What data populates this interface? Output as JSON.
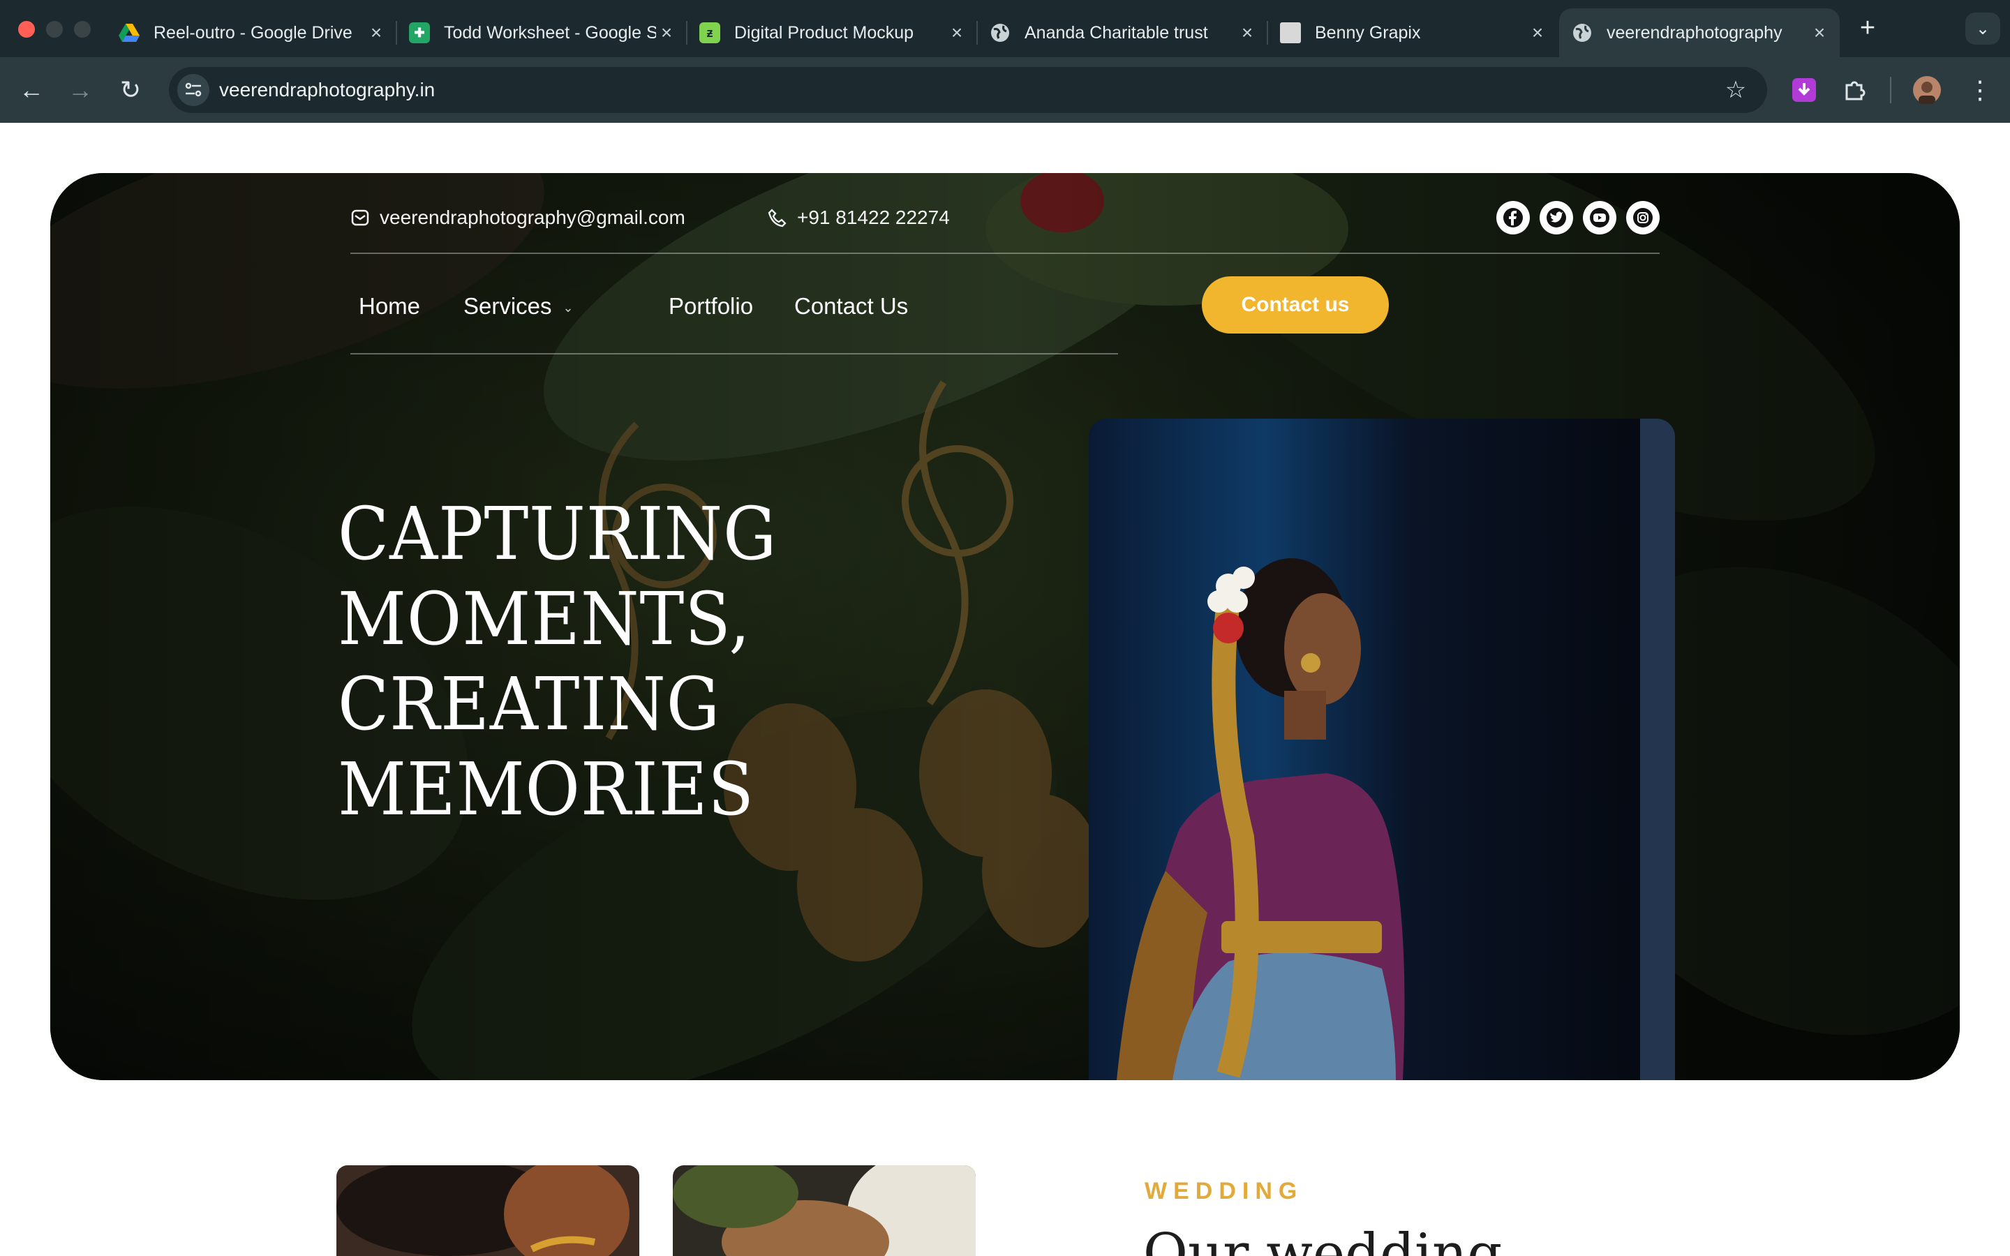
{
  "browser": {
    "tabs": [
      {
        "title": "Reel-outro - Google Drive",
        "favicon": "google-drive-icon",
        "active": false
      },
      {
        "title": "Todd Worksheet - Google Sheets",
        "favicon": "google-sheets-icon",
        "active": false
      },
      {
        "title": "Digital Product Mockup",
        "favicon": "mockup-app-icon",
        "active": false
      },
      {
        "title": "Ananda Charitable trust",
        "favicon": "globe-icon",
        "active": false
      },
      {
        "title": "Benny Grapix",
        "favicon": "site-thumbnail-icon",
        "active": false
      },
      {
        "title": "veerendraphotography",
        "favicon": "globe-icon",
        "active": true
      }
    ],
    "url": "veerendraphotography.in",
    "colors": {
      "tabbar": "#1c2a2f",
      "toolbar": "#2b3b40",
      "close_dot": "#fe5f57"
    }
  },
  "site": {
    "email": "veerendraphotography@gmail.com",
    "phone": "+91 81422 22274",
    "socials": [
      "facebook-icon",
      "twitter-icon",
      "youtube-icon",
      "instagram-icon"
    ],
    "nav": {
      "home": "Home",
      "services": "Services",
      "portfolio": "Portfolio",
      "contact": "Contact Us"
    },
    "cta": "Contact us",
    "headline": [
      "CAPTURING",
      "MOMENTS,",
      "CREATING",
      "MEMORIES"
    ],
    "section": {
      "eyebrow": "WEDDING",
      "title": "Our wedding"
    },
    "colors": {
      "accent": "#f1b52e",
      "eyebrow": "#e2aa3a"
    }
  }
}
